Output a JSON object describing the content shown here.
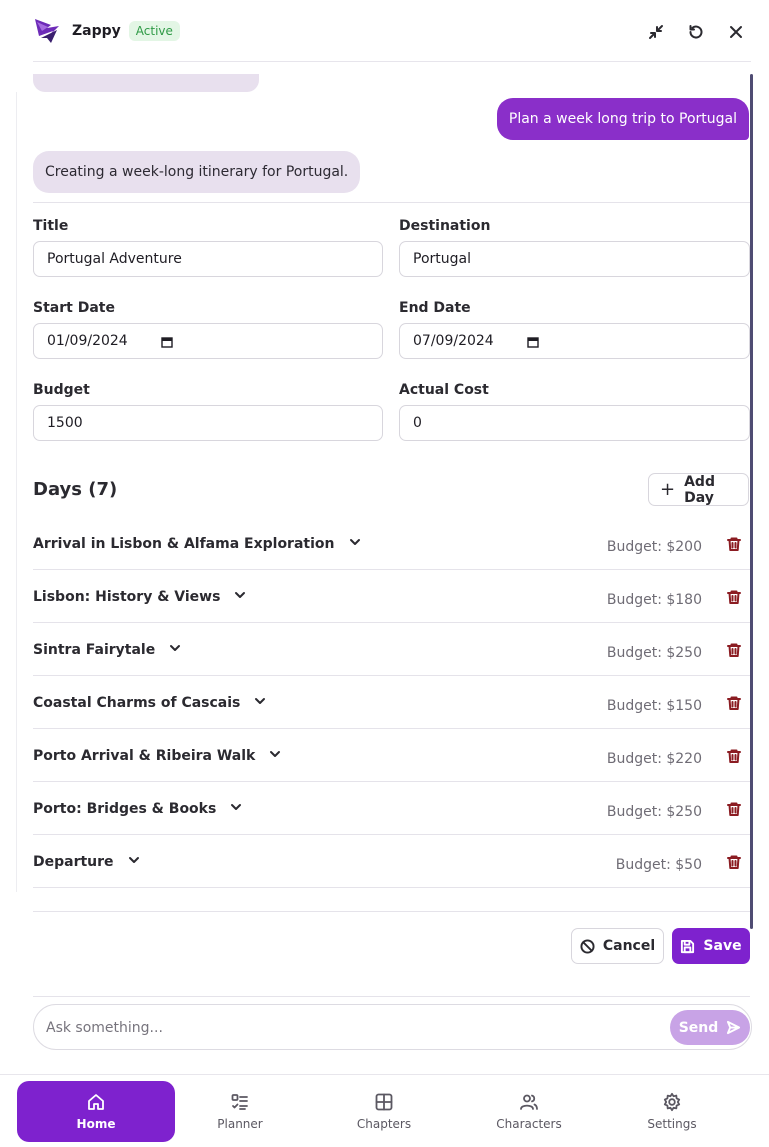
{
  "header": {
    "app_name": "Zappy",
    "status_badge": "Active",
    "icons": [
      "minimize-icon",
      "refresh-icon",
      "close-icon"
    ]
  },
  "chat": {
    "user_message": "Plan a week long trip to Portugal",
    "assistant_message": "Creating a week-long itinerary for Portugal."
  },
  "form": {
    "title": {
      "label": "Title",
      "value": "Portugal Adventure"
    },
    "destination": {
      "label": "Destination",
      "value": "Portugal"
    },
    "start_date": {
      "label": "Start Date",
      "value": "01/09/2024"
    },
    "end_date": {
      "label": "End Date",
      "value": "07/09/2024"
    },
    "budget": {
      "label": "Budget",
      "value": "1500"
    },
    "actual_cost": {
      "label": "Actual Cost",
      "value": "0"
    }
  },
  "days": {
    "heading": "Days (7)",
    "add_label": "Add Day",
    "items": [
      {
        "title": "Arrival in Lisbon & Alfama Exploration",
        "budget": "Budget: $200"
      },
      {
        "title": "Lisbon: History & Views",
        "budget": "Budget: $180"
      },
      {
        "title": "Sintra Fairytale",
        "budget": "Budget: $250"
      },
      {
        "title": "Coastal Charms of Cascais",
        "budget": "Budget: $150"
      },
      {
        "title": "Porto Arrival & Ribeira Walk",
        "budget": "Budget: $220"
      },
      {
        "title": "Porto: Bridges & Books",
        "budget": "Budget: $250"
      },
      {
        "title": "Departure",
        "budget": "Budget: $50"
      }
    ]
  },
  "actions": {
    "cancel": "Cancel",
    "save": "Save"
  },
  "composer": {
    "placeholder": "Ask something...",
    "send": "Send"
  },
  "nav": {
    "active": "home",
    "items": [
      {
        "label": "Home",
        "icon": "home-icon"
      },
      {
        "label": "Planner",
        "icon": "checklist-icon"
      },
      {
        "label": "Chapters",
        "icon": "grid-icon"
      },
      {
        "label": "Characters",
        "icon": "users-icon"
      },
      {
        "label": "Settings",
        "icon": "gear-icon"
      }
    ]
  },
  "colors": {
    "accent": "#7e22ce",
    "user_bubble": "#8a2fc9",
    "assistant_bubble": "#e8e0ee",
    "badge_text": "#2e9a45",
    "danger": "#8b1c22"
  }
}
